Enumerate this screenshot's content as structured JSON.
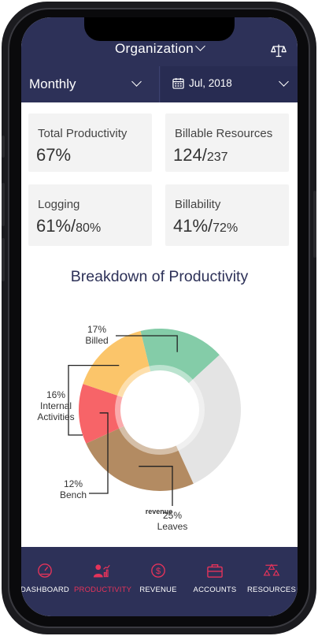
{
  "header": {
    "title": "Organization"
  },
  "filters": {
    "period": "Monthly",
    "date": "Jul, 2018"
  },
  "metrics": [
    {
      "label": "Total Productivity",
      "value": "67%",
      "suffix": ""
    },
    {
      "label": "Billable Resources",
      "value": "124/",
      "suffix": "237"
    },
    {
      "label": "Logging",
      "value": "61%/",
      "suffix": "80%"
    },
    {
      "label": "Billability",
      "value": "41%/",
      "suffix": "72%"
    }
  ],
  "section_title": "Breakdown of Productivity",
  "chart_data": {
    "type": "pie",
    "title": "Breakdown of Productivity",
    "slices": [
      {
        "label": "Billed",
        "value": 17,
        "pct_text": "17%",
        "color": "#84cca8"
      },
      {
        "label": "",
        "value": 30,
        "pct_text": "",
        "color": "#e4e4e4"
      },
      {
        "label": "Leaves",
        "value": 25,
        "pct_text": "25%",
        "color": "#b38b62"
      },
      {
        "label": "Bench",
        "value": 12,
        "pct_text": "12%",
        "color": "#f76468"
      },
      {
        "label": "Internal Activities",
        "value": 16,
        "pct_text": "16%",
        "color": "#fbc56a"
      }
    ],
    "annotation": "revenue"
  },
  "tabs": [
    {
      "label": "DASHBOARD",
      "icon": "gauge-icon",
      "active": false
    },
    {
      "label": "PRODUCTIVITY",
      "icon": "user-chart-icon",
      "active": true
    },
    {
      "label": "REVENUE",
      "icon": "dollar-icon",
      "active": false
    },
    {
      "label": "ACCOUNTS",
      "icon": "briefcase-icon",
      "active": false
    },
    {
      "label": "RESOURCES",
      "icon": "people-icon",
      "active": false
    }
  ],
  "colors": {
    "navy": "#2d3158",
    "active": "#e6335a"
  }
}
